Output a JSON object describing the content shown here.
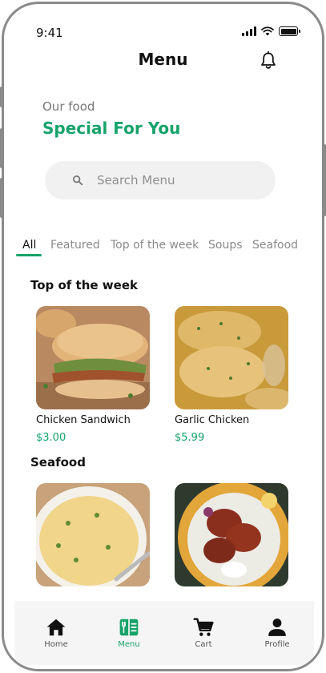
{
  "status_bar": {
    "time": "9:41"
  },
  "header": {
    "title": "Menu",
    "bell_icon": "bell-icon"
  },
  "hero": {
    "subtitle": "Our food",
    "title": "Special For You"
  },
  "search": {
    "placeholder": "Search Menu",
    "value": ""
  },
  "tabs": [
    {
      "label": "All",
      "active": true
    },
    {
      "label": "Featured",
      "active": false
    },
    {
      "label": "Top of the week",
      "active": false
    },
    {
      "label": "Soups",
      "active": false
    },
    {
      "label": "Seafood",
      "active": false
    }
  ],
  "sections": [
    {
      "title": "Top of the week",
      "items": [
        {
          "name": "Chicken Sandwich",
          "price": "$3.00"
        },
        {
          "name": "Garlic Chicken",
          "price": "$5.99"
        }
      ]
    },
    {
      "title": "Seafood",
      "items": [
        {
          "name": "",
          "price": ""
        },
        {
          "name": "",
          "price": ""
        }
      ]
    }
  ],
  "bottom_nav": [
    {
      "label": "Home",
      "icon": "home-icon",
      "active": false
    },
    {
      "label": "Menu",
      "icon": "menu-icon",
      "active": true
    },
    {
      "label": "Cart",
      "icon": "cart-icon",
      "active": false
    },
    {
      "label": "Profile",
      "icon": "profile-icon",
      "active": false
    }
  ],
  "colors": {
    "accent": "#16a36a",
    "search_bg": "#f1f1f1",
    "nav_bg": "#f5f5f5"
  }
}
